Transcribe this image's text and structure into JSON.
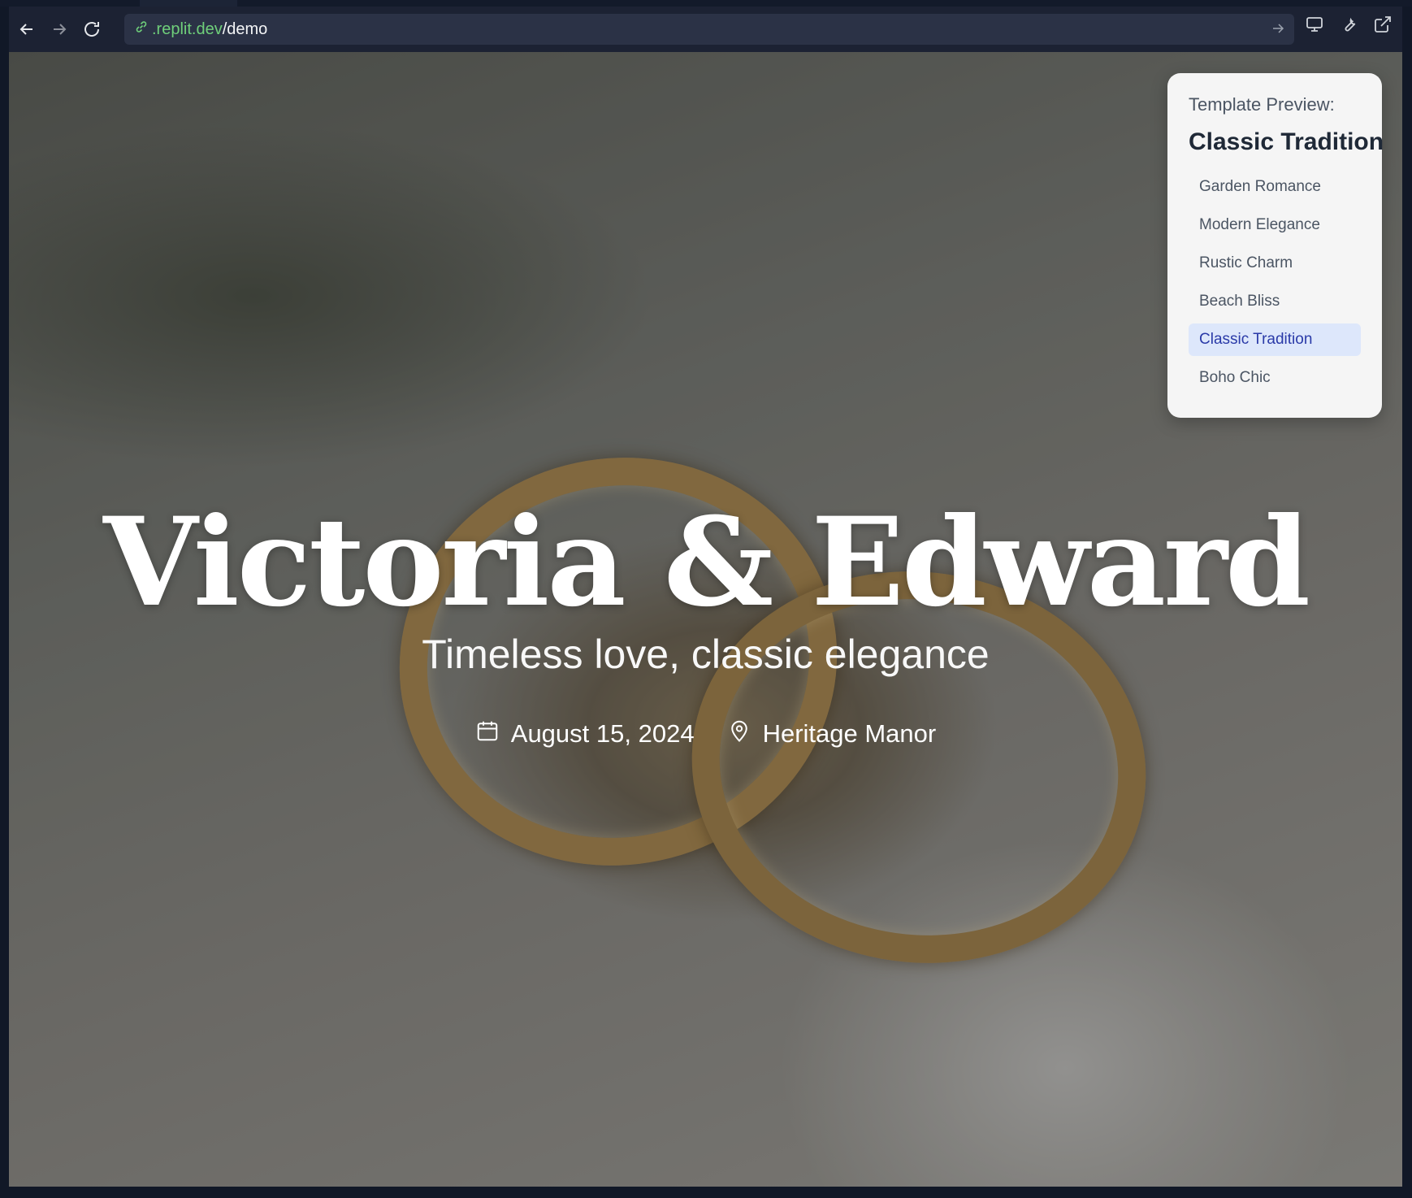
{
  "browser": {
    "url_host": ".replit.dev",
    "url_path": "/demo",
    "icons": [
      "back-arrow-icon",
      "forward-arrow-icon",
      "reload-icon",
      "link-icon",
      "go-arrow-icon",
      "monitor-icon",
      "wrench-icon",
      "external-link-icon"
    ]
  },
  "hero": {
    "title": "Victoria & Edward",
    "subtitle": "Timeless love, classic elegance",
    "date": "August 15, 2024",
    "venue": "Heritage Manor"
  },
  "template_panel": {
    "label": "Template Preview:",
    "current": "Classic Tradition",
    "items": [
      {
        "label": "Garden Romance",
        "active": false
      },
      {
        "label": "Modern Elegance",
        "active": false
      },
      {
        "label": "Rustic Charm",
        "active": false
      },
      {
        "label": "Beach Bliss",
        "active": false
      },
      {
        "label": "Classic Tradition",
        "active": true
      },
      {
        "label": "Boho Chic",
        "active": false
      }
    ],
    "active_color": "#2a3aa8"
  }
}
